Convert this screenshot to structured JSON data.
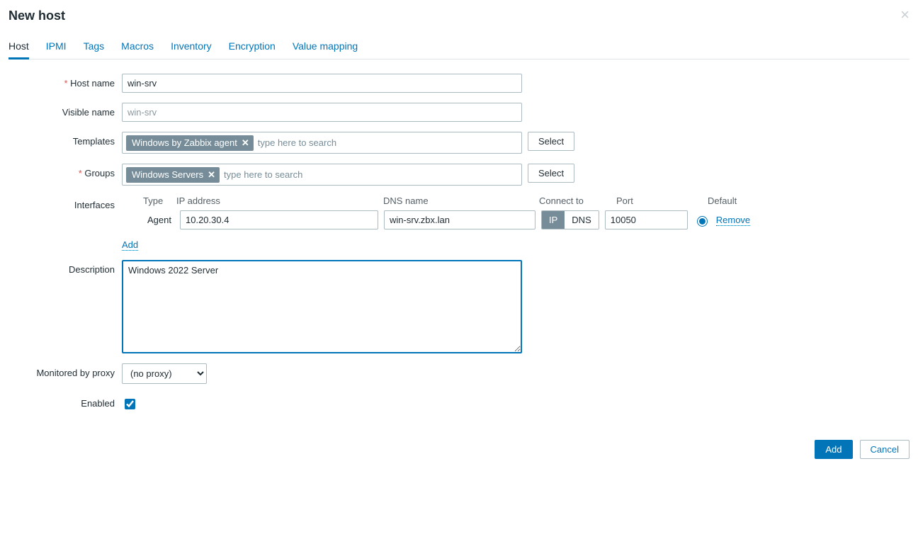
{
  "title": "New host",
  "tabs": [
    "Host",
    "IPMI",
    "Tags",
    "Macros",
    "Inventory",
    "Encryption",
    "Value mapping"
  ],
  "active_tab_index": 0,
  "labels": {
    "host_name": "Host name",
    "visible_name": "Visible name",
    "templates": "Templates",
    "groups": "Groups",
    "interfaces": "Interfaces",
    "description": "Description",
    "monitored_by_proxy": "Monitored by proxy",
    "enabled": "Enabled"
  },
  "fields": {
    "host_name": "win-srv",
    "visible_name_placeholder": "win-srv",
    "templates_tag": "Windows by Zabbix agent",
    "groups_tag": "Windows Servers",
    "search_placeholder": "type here to search",
    "select_btn": "Select",
    "description": "Windows 2022 Server",
    "proxy_option": "(no proxy)",
    "enabled": true
  },
  "interfaces": {
    "headers": {
      "type": "Type",
      "ip": "IP address",
      "dns": "DNS name",
      "connect": "Connect to",
      "port": "Port",
      "default": "Default"
    },
    "row": {
      "type": "Agent",
      "ip": "10.20.30.4",
      "dns": "win-srv.zbx.lan",
      "connect_ip": "IP",
      "connect_dns": "DNS",
      "port": "10050",
      "remove": "Remove"
    },
    "add": "Add"
  },
  "footer": {
    "add": "Add",
    "cancel": "Cancel"
  }
}
